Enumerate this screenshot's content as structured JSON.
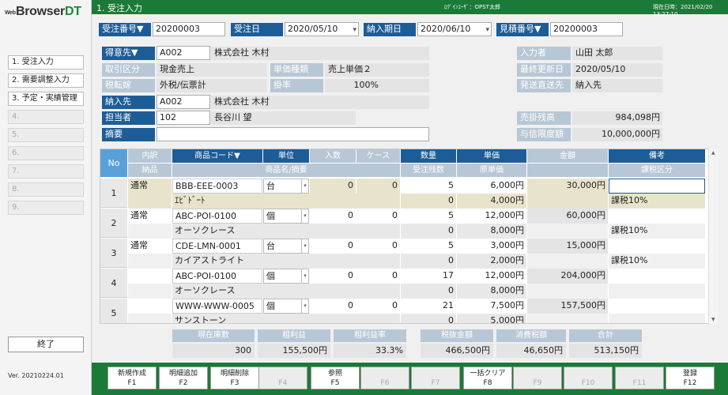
{
  "app": {
    "logo_small": "Web",
    "logo_main": "Browser",
    "logo_dt": "DT",
    "version": "Ver. 20210224.01",
    "quit": "終了"
  },
  "header": {
    "title": "1. 受注入力",
    "login": "ﾛｸﾞｲﾝﾕｰｻﾞ：OPST太郎",
    "datetime": "現在日時：2021/02/20 13:27:10"
  },
  "menu": [
    "1. 受注入力",
    "2. 需要調整入力",
    "3. 予定・実績管理",
    "4.",
    "5.",
    "6.",
    "7.",
    "8.",
    "9."
  ],
  "top": {
    "order_no_label": "受注番号▼",
    "order_no": "20200003",
    "order_date_label": "受注日",
    "order_date": "2020/05/10",
    "delivery_date_label": "納入期日",
    "delivery_date": "2020/06/10",
    "estimate_no_label": "見積番号▼",
    "estimate_no": "20200003"
  },
  "form": {
    "customer_label": "得意先▼",
    "customer_code": "A002",
    "customer_name": "株式会社 木村",
    "trade_type_label": "取引区分",
    "trade_type": "現金売上",
    "price_type_label": "単価種類",
    "price_type": "売上単価２",
    "tax_label": "税転嫁",
    "tax": "外税/伝票計",
    "rate_label": "掛率",
    "rate": "100%",
    "delivery_label": "納入先",
    "delivery_code": "A002",
    "delivery_name": "株式会社 木村",
    "staff_label": "担当者",
    "staff_code": "102",
    "staff_name": "長谷川 望",
    "memo_label": "摘要",
    "entry_user_label": "入力者",
    "entry_user": "山田 太郎",
    "updated_label": "最終更新日",
    "updated": "2020/05/10",
    "ship_label": "発送直送先",
    "ship": "納入先",
    "ar_label": "売掛残高",
    "ar": "984,098円",
    "credit_label": "与信限度額",
    "credit": "10,000,000円"
  },
  "grid": {
    "headers": {
      "no": "No",
      "type": "内訳",
      "code": "商品コード▼",
      "unit": "単位",
      "qty_in": "入数",
      "case": "ケース",
      "qty": "数量",
      "price": "単価",
      "amount": "金額",
      "note": "備考",
      "delivered": "納品",
      "name": "商品名/摘要",
      "remain": "受注残数",
      "cost": "原単価",
      "tax_class": "課税区分"
    },
    "rows": [
      {
        "no": "1",
        "type": "通常",
        "code": "BBB-EEE-0003",
        "unit": "台",
        "qty_in": "0",
        "case": "0",
        "qty": "5",
        "price": "6,000円",
        "amount": "30,000円",
        "note": "",
        "name": "ｴﾋﾞﾄﾞｰﾄ",
        "remain": "0",
        "cost": "4,000円",
        "tax_class": "課税10%"
      },
      {
        "no": "2",
        "type": "通常",
        "code": "ABC-POI-0100",
        "unit": "個",
        "qty_in": "0",
        "case": "0",
        "qty": "5",
        "price": "12,000円",
        "amount": "60,000円",
        "note": "",
        "name": "オーソクレース",
        "remain": "0",
        "cost": "8,000円",
        "tax_class": "課税10%"
      },
      {
        "no": "3",
        "type": "通常",
        "code": "CDE-LMN-0001",
        "unit": "台",
        "qty_in": "0",
        "case": "0",
        "qty": "5",
        "price": "3,000円",
        "amount": "15,000円",
        "note": "",
        "name": "カイアストライト",
        "remain": "0",
        "cost": "2,000円",
        "tax_class": "課税10%"
      },
      {
        "no": "4",
        "type": "",
        "code": "ABC-POI-0100",
        "unit": "個",
        "qty_in": "0",
        "case": "0",
        "qty": "17",
        "price": "12,000円",
        "amount": "204,000円",
        "note": "",
        "name": "オーソクレース",
        "remain": "0",
        "cost": "8,000円",
        "tax_class": ""
      },
      {
        "no": "5",
        "type": "",
        "code": "WWW-WWW-0005",
        "unit": "個",
        "qty_in": "0",
        "case": "0",
        "qty": "21",
        "price": "7,500円",
        "amount": "157,500円",
        "note": "",
        "name": "サンストーン",
        "remain": "0",
        "cost": "5,000円",
        "tax_class": ""
      }
    ]
  },
  "summary": {
    "stock_label": "現在庫数",
    "stock": "300",
    "profit_label": "粗利益",
    "profit": "155,500円",
    "margin_label": "粗利益率",
    "margin": "33.3%",
    "pretax_label": "税抜金額",
    "pretax": "466,500円",
    "tax_label": "消費税額",
    "tax": "46,650円",
    "total_label": "合計",
    "total": "513,150円"
  },
  "fkeys": [
    {
      "label": "新規作成",
      "key": "F1"
    },
    {
      "label": "明細追加",
      "key": "F2"
    },
    {
      "label": "明細削除",
      "key": "F3"
    },
    {
      "label": "",
      "key": "F4"
    },
    {
      "label": "参照",
      "key": "F5"
    },
    {
      "label": "",
      "key": "F6"
    },
    {
      "label": "",
      "key": "F7"
    },
    {
      "label": "一括クリア",
      "key": "F8"
    },
    {
      "label": "",
      "key": "F9"
    },
    {
      "label": "",
      "key": "F10"
    },
    {
      "label": "",
      "key": "F11"
    },
    {
      "label": "登録",
      "key": "F12"
    }
  ],
  "colors": {
    "header_green": "#1b7a37",
    "label_blue": "#1c5d98",
    "label_light": "#b8c7d5",
    "row_highlight": "#e8e4cc"
  }
}
